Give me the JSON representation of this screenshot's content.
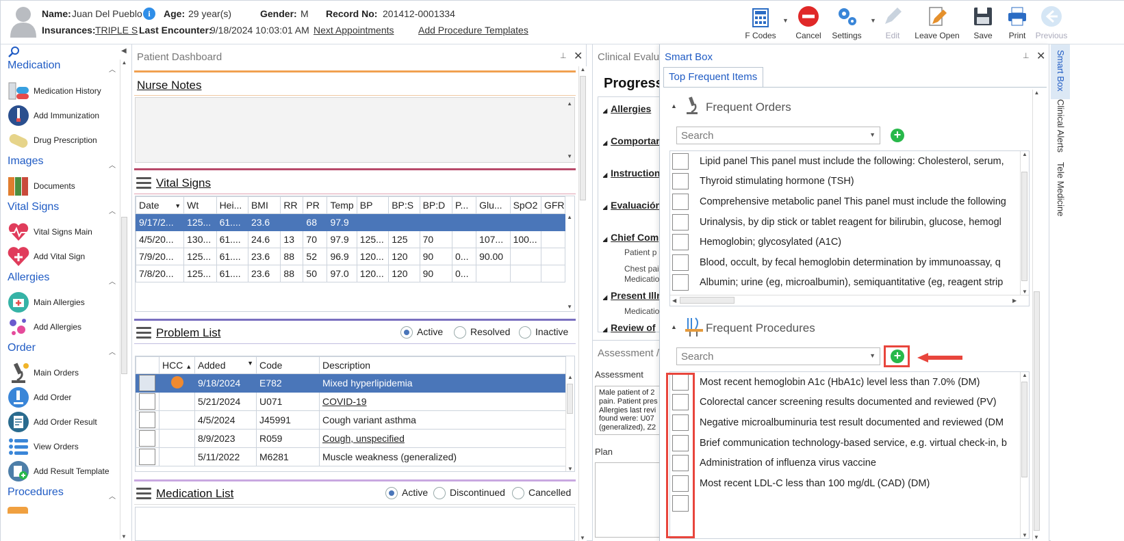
{
  "header": {
    "name_label": "Name:",
    "name_value": "Juan Del Pueblo",
    "age_label": "Age:",
    "age_value": "29 year(s)",
    "gender_label": "Gender:",
    "gender_value": "M",
    "record_label": "Record No:",
    "record_value": "201412-0001334",
    "insurances_label": "Insurances:",
    "insurances_value": "TRIPLE S",
    "last_enc_label": "Last Encounter:",
    "last_enc_value": "9/18/2024 10:03:01 AM",
    "next_appointments": "Next Appointments",
    "add_procedure_templates": "Add Procedure Templates",
    "toolbar": {
      "fcodes": "F Codes",
      "cancel": "Cancel",
      "settings": "Settings",
      "edit": "Edit",
      "leave_open": "Leave Open",
      "save": "Save",
      "print": "Print",
      "previous": "Previous"
    }
  },
  "sidebar": {
    "sections": {
      "medication": "Medication",
      "images": "Images",
      "vital_signs": "Vital Signs",
      "allergies": "Allergies",
      "order": "Order",
      "procedures": "Procedures"
    },
    "items": {
      "medication_history": "Medication History",
      "add_immunization": "Add Immunization",
      "drug_prescription": "Drug Prescription",
      "documents": "Documents",
      "vital_signs_main": "Vital Signs Main",
      "add_vital_sign": "Add Vital Sign",
      "main_allergies": "Main Allergies",
      "add_allergies": "Add Allergies",
      "main_orders": "Main Orders",
      "add_order": "Add Order",
      "add_order_result": "Add Order Result",
      "view_orders": "View Orders",
      "add_result_template": "Add Result Template"
    }
  },
  "dashboard": {
    "title": "Patient Dashboard",
    "nurse_notes": "Nurse Notes",
    "vital_signs": "Vital Signs",
    "vitals_columns": [
      "Date",
      "Wt",
      "Hei...",
      "BMI",
      "RR",
      "PR",
      "Temp",
      "BP",
      "BP:S",
      "BP:D",
      "P...",
      "Glu...",
      "SpO2",
      "GFR"
    ],
    "vitals_rows": [
      [
        "9/17/2...",
        "125...",
        "61....",
        "23.6",
        "",
        "68",
        "97.9",
        "",
        "",
        "",
        "",
        "",
        "",
        ""
      ],
      [
        "4/5/20...",
        "130...",
        "61....",
        "24.6",
        "13",
        "70",
        "97.9",
        "125...",
        "125",
        "70",
        "",
        "107...",
        "100...",
        ""
      ],
      [
        "7/9/20...",
        "125...",
        "61....",
        "23.6",
        "88",
        "52",
        "96.9",
        "120...",
        "120",
        "90",
        "0...",
        "90.00",
        "",
        ""
      ],
      [
        "7/8/20...",
        "125...",
        "61....",
        "23.6",
        "88",
        "50",
        "97.0",
        "120...",
        "120",
        "90",
        "0...",
        "",
        "",
        ""
      ]
    ],
    "problem_list": "Problem List",
    "problem_filters": [
      "Active",
      "Resolved",
      "Inactive"
    ],
    "problem_columns": [
      "",
      "HCC",
      "Added",
      "Code",
      "Description"
    ],
    "problem_rows": [
      {
        "added": "9/18/2024",
        "code": "E782",
        "desc": "Mixed hyperlipidemia"
      },
      {
        "added": "5/21/2024",
        "code": "U071",
        "desc": "COVID-19"
      },
      {
        "added": "4/5/2024",
        "code": "J45991",
        "desc": "Cough variant asthma"
      },
      {
        "added": "8/9/2023",
        "code": "R059",
        "desc": "Cough, unspecified"
      },
      {
        "added": "5/11/2022",
        "code": "M6281",
        "desc": "Muscle weakness (generalized)"
      }
    ],
    "medication_list": "Medication List",
    "medication_filters": [
      "Active",
      "Discontinued",
      "Cancelled"
    ]
  },
  "clinical": {
    "title": "Clinical Evalu",
    "heading": "Progress",
    "items": [
      "Allergies",
      "Comportar",
      "Instruction",
      "Evaluación",
      "Chief Com",
      "Present Illn",
      "Review of"
    ],
    "sub_chief": [
      "Patient p",
      "Chest pai",
      "Medicatio"
    ],
    "sub_present": [
      "Medicatio"
    ],
    "assessment_title": "Assessment /",
    "assessment_label": "Assessment",
    "assessment_text": "Male patient of 2 pain. Patient pres Allergies last revi found were: U07 (generalized), Z2",
    "plan_label": "Plan"
  },
  "smartbox": {
    "title": "Smart Box",
    "tab": "Top Frequent Items",
    "orders_title": "Frequent Orders",
    "orders_search": "Search",
    "orders": [
      "Lipid panel This panel must include the following: Cholesterol, serum,",
      "Thyroid stimulating hormone (TSH)",
      "Comprehensive metabolic panel This panel must include the following",
      "Urinalysis, by dip stick or tablet reagent for bilirubin, glucose, hemogl",
      "Hemoglobin; glycosylated (A1C)",
      "Blood, occult, by fecal hemoglobin determination by immunoassay, q",
      "Albumin; urine (eg, microalbumin), semiquantitative (eg, reagent strip"
    ],
    "procedures_title": "Frequent Procedures",
    "procedures_search": "Search",
    "procedures": [
      "Most recent hemoglobin A1c (HbA1c) level less than 7.0% (DM)",
      "Colorectal cancer screening results documented and reviewed (PV)",
      "Negative microalbuminuria test result documented and reviewed (DM",
      "Brief communication technology-based service, e.g. virtual check-in, b",
      "Administration of influenza virus vaccine",
      "Most recent LDL-C less than 100 mg/dL (CAD) (DM)"
    ]
  },
  "side_tabs": [
    "Smart Box",
    "Clinical Alerts",
    "Tele Medicine"
  ],
  "colors": {
    "accent": "#1f5bc4",
    "selected_row": "#4a76b9",
    "highlight": "#e8453c",
    "add_green": "#28b84a"
  }
}
